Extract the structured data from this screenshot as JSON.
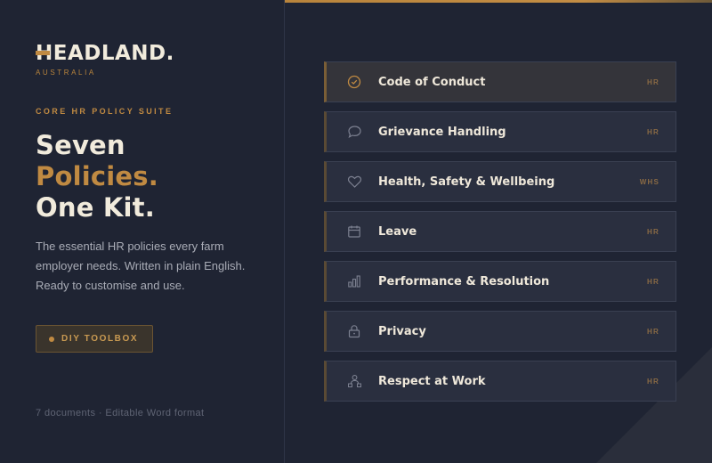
{
  "brand": {
    "name_first_letter": "H",
    "name_rest": "EADLAND.",
    "subtitle": "AUSTRALIA",
    "accent_color": "#c08a42"
  },
  "hero": {
    "eyebrow": "CORE HR POLICY SUITE",
    "line1": "Seven",
    "line2": "Policies.",
    "line3": "One Kit.",
    "intro": "The essential HR policies every farm employer needs. Written in plain English. Ready to customise and use.",
    "cta_label": "DIY TOOLBOX",
    "footnote": "7 documents · Editable Word format"
  },
  "policies": [
    {
      "title": "Code of Conduct",
      "tag": "HR",
      "icon": "check-circle-icon"
    },
    {
      "title": "Grievance Handling",
      "tag": "HR",
      "icon": "speech-bubble-icon"
    },
    {
      "title": "Health, Safety & Wellbeing",
      "tag": "WHS",
      "icon": "heart-icon"
    },
    {
      "title": "Leave",
      "tag": "HR",
      "icon": "calendar-icon"
    },
    {
      "title": "Performance & Resolution",
      "tag": "HR",
      "icon": "bar-chart-icon"
    },
    {
      "title": "Privacy",
      "tag": "HR",
      "icon": "lock-icon"
    },
    {
      "title": "Respect at Work",
      "tag": "HR",
      "icon": "people-icon"
    }
  ],
  "colors": {
    "background": "#1f2433",
    "card": "#2a2f3f",
    "accent": "#c08a42",
    "text": "#efe8da"
  }
}
